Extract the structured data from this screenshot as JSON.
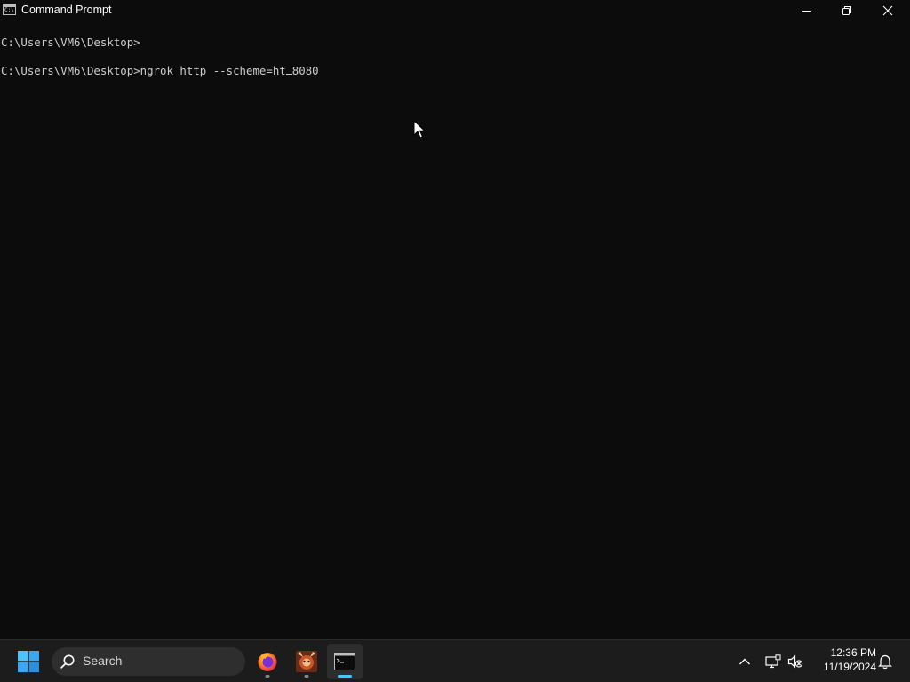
{
  "window": {
    "title": "Command Prompt",
    "app_icon_text": "C:\\",
    "minimize_label": "Minimize",
    "maximize_label": "Restore",
    "close_label": "Close"
  },
  "console": {
    "lines": [
      "C:\\Users\\VM6\\Desktop>",
      "C:\\Users\\VM6\\Desktop>ngrok http --scheme=ht"
    ],
    "line_2_after_cursor": "8080",
    "text_color": "#cccccc",
    "background": "#0c0c0c"
  },
  "taskbar": {
    "search_placeholder": "Search",
    "apps": [
      {
        "name": "Firefox",
        "icon": "firefox-icon",
        "running": true,
        "active": false
      },
      {
        "name": "Game app",
        "icon": "game-app-icon",
        "running": true,
        "active": false
      },
      {
        "name": "Command Prompt",
        "icon": "command-prompt-icon",
        "running": true,
        "active": true
      }
    ],
    "tray": {
      "icons": [
        "chevron-up-icon",
        "network-icon",
        "volume-muted-icon",
        "notification-bell-icon"
      ]
    },
    "clock": {
      "time": "12:36 PM",
      "date": "11/19/2024"
    },
    "accent": "#4cc2ff"
  }
}
